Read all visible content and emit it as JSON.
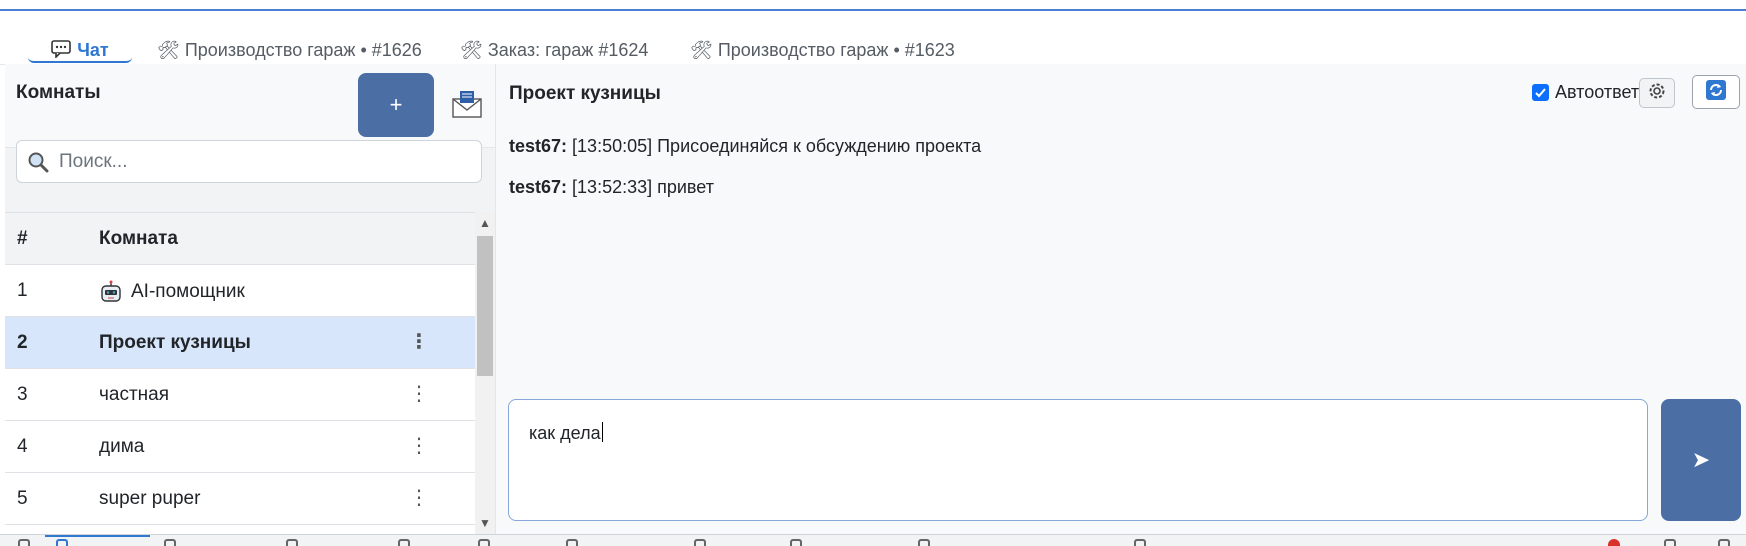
{
  "tabs": [
    {
      "icon": "chat-icon",
      "label": "Чат",
      "active": true
    },
    {
      "icon": "tools-icon",
      "label": "🛠 Производство гараж • #1626"
    },
    {
      "icon": "tools-icon",
      "label": "🛠 Заказ: гараж #1624"
    },
    {
      "icon": "tools-icon",
      "label": "🛠 Производство гараж • #1623"
    }
  ],
  "sidebar": {
    "title": "Комнаты",
    "add_label": "+",
    "search_placeholder": "Поиск...",
    "columns": {
      "num": "#",
      "room": "Комната"
    },
    "rooms": [
      {
        "num": "1",
        "name": "AI-помощник",
        "icon": "robot-icon"
      },
      {
        "num": "2",
        "name": "Проект кузницы",
        "selected": true
      },
      {
        "num": "3",
        "name": "частная"
      },
      {
        "num": "4",
        "name": "дима"
      },
      {
        "num": "5",
        "name": "super puper"
      }
    ],
    "menu_glyph": "⋮"
  },
  "chat": {
    "title": "Проект кузницы",
    "autoreply_label": "Автоответ",
    "autoreply_checked": true,
    "messages": [
      {
        "author": "test67:",
        "text": "[13:50:05] Присоединяйся к обсуждению проекта"
      },
      {
        "author": "test67:",
        "text": "[13:52:33] привет"
      }
    ],
    "draft": "как дела",
    "send_glyph": "➤"
  },
  "colors": {
    "accent": "#2f78d2",
    "button": "#4b6fa5",
    "selected_row": "#d8e6fb"
  }
}
